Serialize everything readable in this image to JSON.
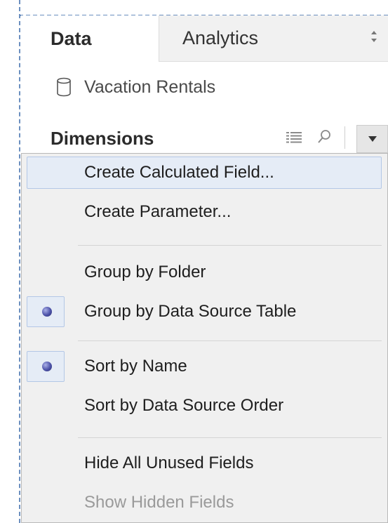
{
  "tabs": {
    "data_label": "Data",
    "analytics_label": "Analytics"
  },
  "data_source": {
    "icon": "database-cylinder-icon",
    "name": "Vacation Rentals"
  },
  "dimensions_header": {
    "title": "Dimensions",
    "icons": [
      "grid-view-icon",
      "search-icon",
      "dropdown-arrow-icon"
    ]
  },
  "context_menu": {
    "items": [
      {
        "label": "Create Calculated Field...",
        "highlighted": true,
        "selected": false,
        "enabled": true
      },
      {
        "label": "Create Parameter...",
        "highlighted": false,
        "selected": false,
        "enabled": true
      },
      {
        "label": "Group by Folder",
        "highlighted": false,
        "selected": false,
        "enabled": true
      },
      {
        "label": "Group by Data Source Table",
        "highlighted": false,
        "selected": true,
        "enabled": true
      },
      {
        "label": "Sort by Name",
        "highlighted": false,
        "selected": true,
        "enabled": true
      },
      {
        "label": "Sort by Data Source Order",
        "highlighted": false,
        "selected": false,
        "enabled": true
      },
      {
        "label": "Hide All Unused Fields",
        "highlighted": false,
        "selected": false,
        "enabled": true
      },
      {
        "label": "Show Hidden Fields",
        "highlighted": false,
        "selected": false,
        "enabled": false
      }
    ]
  },
  "colors": {
    "highlight_bg": "#e5ecf6",
    "highlight_border": "#b3c7e6",
    "radio_dot": "#4c52a8",
    "menu_bg": "#f0f0f0",
    "disabled_text": "#9a9a9a"
  }
}
